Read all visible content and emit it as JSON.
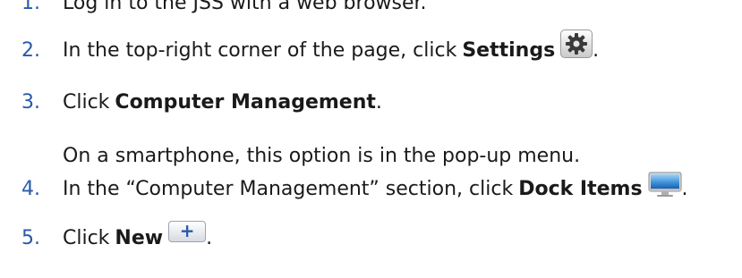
{
  "steps": [
    {
      "number": "1.",
      "text": "Log in to the JSS with a web browser."
    },
    {
      "number": "2.",
      "text_before": "In the top-right corner of the page, click",
      "bold": "Settings",
      "text_after": ".",
      "icon": "settings-gear-icon"
    },
    {
      "number": "3.",
      "text_before": "Click",
      "bold": "Computer Management",
      "text_after": ".",
      "note": "On a smartphone, this option is in the pop-up menu."
    },
    {
      "number": "4.",
      "text_before": "In the “Computer Management” section, click",
      "bold": "Dock Items",
      "text_after": ".",
      "icon": "monitor-icon"
    },
    {
      "number": "5.",
      "text_before": "Click",
      "bold": "New",
      "text_after": ".",
      "icon": "plus-icon",
      "icon_glyph": "+"
    }
  ],
  "colors": {
    "step_number": "#2a5aa8",
    "text": "#1a1a1a"
  }
}
